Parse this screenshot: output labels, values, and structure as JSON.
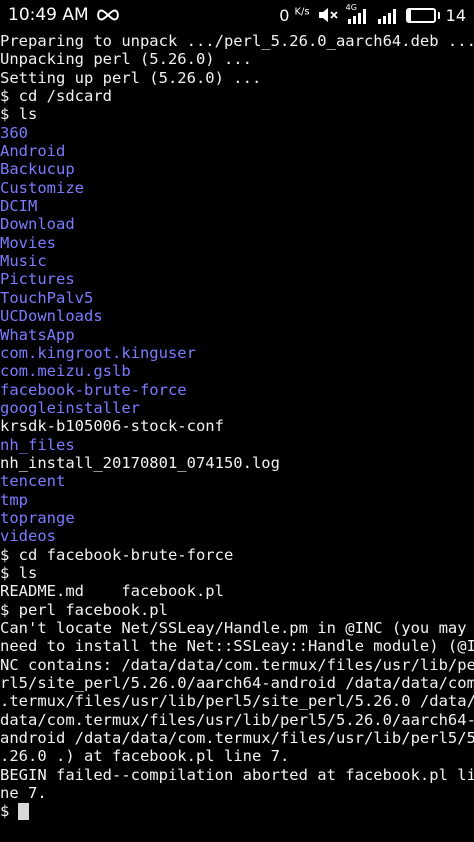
{
  "status_bar": {
    "time": "10:49 AM",
    "net_speed_value": "0",
    "net_speed_unit": "K/s",
    "network_type": "4G",
    "battery_level": "14",
    "battery_fraction": 0.14
  },
  "terminal": {
    "lines": [
      {
        "text": "Preparing to unpack .../perl_5.26.0_aarch64.deb ...",
        "kind": "text"
      },
      {
        "text": "Unpacking perl (5.26.0) ...",
        "kind": "text"
      },
      {
        "text": "Setting up perl (5.26.0) ...",
        "kind": "text"
      },
      {
        "text": "$ cd /sdcard",
        "kind": "text"
      },
      {
        "text": "$ ls",
        "kind": "text"
      },
      {
        "text": "360",
        "kind": "dir"
      },
      {
        "text": "Android",
        "kind": "dir"
      },
      {
        "text": "Backucup",
        "kind": "dir"
      },
      {
        "text": "Customize",
        "kind": "dir"
      },
      {
        "text": "DCIM",
        "kind": "dir"
      },
      {
        "text": "Download",
        "kind": "dir"
      },
      {
        "text": "Movies",
        "kind": "dir"
      },
      {
        "text": "Music",
        "kind": "dir"
      },
      {
        "text": "Pictures",
        "kind": "dir"
      },
      {
        "text": "TouchPalv5",
        "kind": "dir"
      },
      {
        "text": "UCDownloads",
        "kind": "dir"
      },
      {
        "text": "WhatsApp",
        "kind": "dir"
      },
      {
        "text": "com.kingroot.kinguser",
        "kind": "dir"
      },
      {
        "text": "com.meizu.gslb",
        "kind": "dir"
      },
      {
        "text": "facebook-brute-force",
        "kind": "dir"
      },
      {
        "text": "googleinstaller",
        "kind": "dir"
      },
      {
        "text": "krsdk-b105006-stock-conf",
        "kind": "text"
      },
      {
        "text": "nh_files",
        "kind": "dir"
      },
      {
        "text": "nh_install_20170801_074150.log",
        "kind": "text"
      },
      {
        "text": "tencent",
        "kind": "dir"
      },
      {
        "text": "tmp",
        "kind": "dir"
      },
      {
        "text": "toprange",
        "kind": "dir"
      },
      {
        "text": "videos",
        "kind": "dir"
      },
      {
        "text": "$ cd facebook-brute-force",
        "kind": "text"
      },
      {
        "text": "$ ls",
        "kind": "text"
      },
      {
        "text": "README.md    facebook.pl",
        "kind": "text"
      },
      {
        "text": "$ perl facebook.pl",
        "kind": "text"
      },
      {
        "text": "Can't locate Net/SSLeay/Handle.pm in @INC (you may",
        "kind": "text"
      },
      {
        "text": "need to install the Net::SSLeay::Handle module) (@I",
        "kind": "text"
      },
      {
        "text": "NC contains: /data/data/com.termux/files/usr/lib/pe",
        "kind": "text"
      },
      {
        "text": "rl5/site_perl/5.26.0/aarch64-android /data/data/com",
        "kind": "text"
      },
      {
        "text": ".termux/files/usr/lib/perl5/site_perl/5.26.0 /data/",
        "kind": "text"
      },
      {
        "text": "data/com.termux/files/usr/lib/perl5/5.26.0/aarch64-",
        "kind": "text"
      },
      {
        "text": "android /data/data/com.termux/files/usr/lib/perl5/5",
        "kind": "text"
      },
      {
        "text": ".26.0 .) at facebook.pl line 7.",
        "kind": "text"
      },
      {
        "text": "BEGIN failed--compilation aborted at facebook.pl li",
        "kind": "text"
      },
      {
        "text": "ne 7.",
        "kind": "text"
      }
    ],
    "prompt": "$"
  }
}
